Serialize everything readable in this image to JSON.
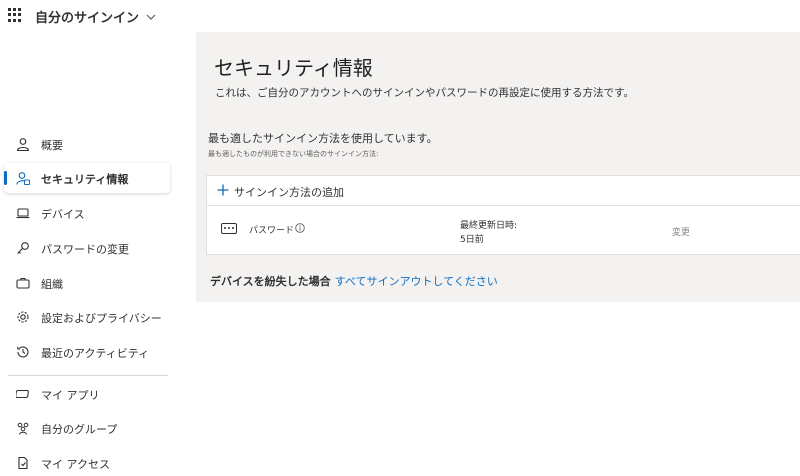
{
  "header": {
    "app_title": "自分のサインイン"
  },
  "sidebar": {
    "items": [
      {
        "label": "概要",
        "icon": "person-icon"
      },
      {
        "label": "セキュリティ情報",
        "icon": "security-info-icon",
        "active": true
      },
      {
        "label": "デバイス",
        "icon": "laptop-icon"
      },
      {
        "label": "パスワードの変更",
        "icon": "key-icon"
      },
      {
        "label": "組織",
        "icon": "briefcase-icon"
      },
      {
        "label": "設定およびプライバシー",
        "icon": "gear-icon"
      },
      {
        "label": "最近のアクティビティ",
        "icon": "history-icon"
      }
    ],
    "bottom_items": [
      {
        "label": "マイ アプリ",
        "icon": "apps-icon"
      },
      {
        "label": "自分のグループ",
        "icon": "groups-icon"
      },
      {
        "label": "マイ アクセス",
        "icon": "access-icon"
      }
    ]
  },
  "main": {
    "title": "セキュリティ情報",
    "description": "これは、ご自分のアカウントへのサインインやパスワードの再設定に使用する方法です。",
    "default_method_title": "最も適したサインイン方法を使用しています。",
    "default_method_sub": "最も適したものが利用できない場合のサインイン方法:",
    "add_method_label": "サインイン方法の追加",
    "methods": [
      {
        "name": "パスワード",
        "updated_label": "最終更新日時:",
        "updated_value": "5日前",
        "action": "変更"
      }
    ],
    "lost_device_label": "デバイスを紛失した場合",
    "lost_device_link": "すべてサインアウトしてください"
  },
  "colors": {
    "accent": "#0f6cbd",
    "main_bg": "#f3f2f1",
    "text": "#323130"
  }
}
